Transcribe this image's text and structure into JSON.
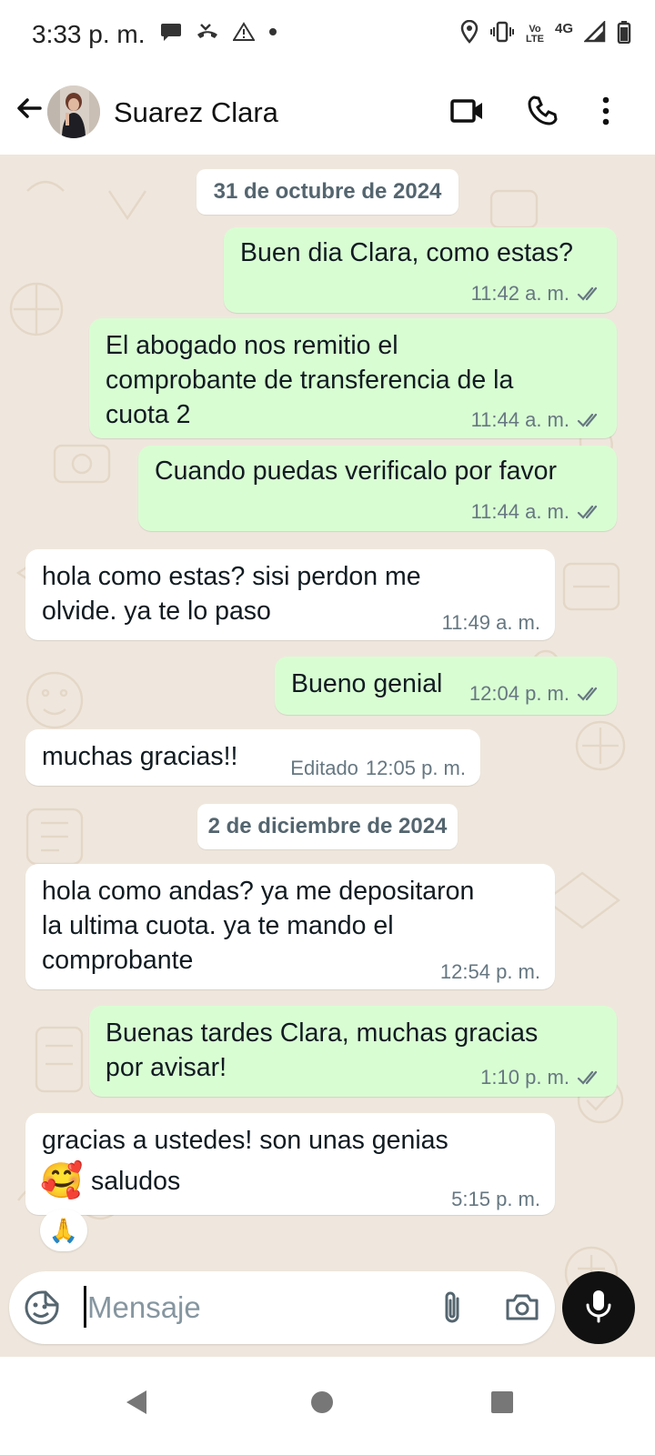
{
  "status_bar": {
    "time": "3:33 p. m.",
    "volte_top": "Vo",
    "volte_bottom": "LTE",
    "network": "4G",
    "icons": [
      "chat-bubble-icon",
      "missed-call-icon",
      "warning-icon",
      "dot-icon",
      "location-icon",
      "vibrate-icon",
      "signal-icon",
      "battery-icon"
    ]
  },
  "header": {
    "contact_name": "Suarez Clara",
    "icons": [
      "back-arrow-icon",
      "avatar",
      "video-call-icon",
      "phone-call-icon",
      "more-options-icon"
    ]
  },
  "chat": {
    "dates": [
      "31 de octubre de 2024",
      "2 de diciembre de 2024"
    ],
    "messages": [
      {
        "direction": "out",
        "text": "Buen dia Clara, como estas?",
        "time": "11:42 a. m.",
        "read": true
      },
      {
        "direction": "out",
        "text": "El abogado nos remitio el\ncomprobante de transferencia de la\ncuota 2",
        "time": "11:44 a. m.",
        "read": true
      },
      {
        "direction": "out",
        "text": "Cuando puedas verificalo por favor",
        "time": "11:44 a. m.",
        "read": true
      },
      {
        "direction": "in",
        "text": "hola como estas? sisi perdon me\nolvide. ya te lo paso",
        "time": "11:49 a. m."
      },
      {
        "direction": "out",
        "text": "Bueno genial",
        "time": "12:04 p. m.",
        "read": true
      },
      {
        "direction": "in",
        "text": "muchas gracias!!",
        "time": "12:05 p. m.",
        "edited_label": "Editado"
      },
      {
        "direction": "in",
        "text": "hola como andas? ya me depositaron\nla ultima cuota. ya te mando el\ncomprobante",
        "time": "12:54 p. m."
      },
      {
        "direction": "out",
        "text": "Buenas tardes Clara, muchas gracias\npor avisar!",
        "time": "1:10 p. m.",
        "read": true
      },
      {
        "direction": "in",
        "text_line1": "gracias a ustedes! son unas genias",
        "emoji": "🥰",
        "text_line2": "saludos",
        "time": "5:15 p. m.",
        "reaction": "🙏"
      }
    ]
  },
  "composer": {
    "placeholder": "Mensaje",
    "icons": [
      "sticker-icon",
      "attach-icon",
      "camera-icon",
      "mic-icon"
    ]
  },
  "nav_bar": {
    "icons": [
      "nav-back-icon",
      "nav-home-icon",
      "nav-recents-icon"
    ]
  },
  "colors": {
    "outgoing_bubble": "#d9fdd3",
    "incoming_bubble": "#ffffff",
    "chat_background": "#efe7dd",
    "read_tick": "#667781"
  }
}
